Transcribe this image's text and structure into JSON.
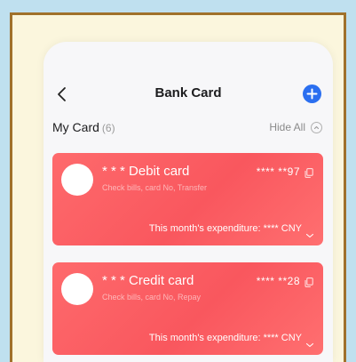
{
  "header": {
    "title": "Bank Card"
  },
  "section": {
    "title": "My Card",
    "count": "(6)",
    "hide_all_label": "Hide All"
  },
  "cards": [
    {
      "name": "* * * Debit card",
      "subtitle": "Check bills, card No, Transfer",
      "number": "**** **97",
      "expenditure": "This month's expenditure: **** CNY"
    },
    {
      "name": "* * * Credit card",
      "subtitle": "Check bills, card No, Repay",
      "number": "**** **28",
      "expenditure": "This month's expenditure: **** CNY"
    }
  ],
  "colors": {
    "accent": "#2b6ff0",
    "card_red": "#f9575e",
    "frame_border": "#a0712b",
    "frame_fill": "#fbf6dd",
    "outer_bg": "#bfe0ef"
  },
  "icons": {
    "back": "chevron-left-icon",
    "add": "plus-circle-icon",
    "hide": "chevron-up-circle-icon",
    "copy": "copy-icon",
    "expand": "chevron-down-icon"
  }
}
